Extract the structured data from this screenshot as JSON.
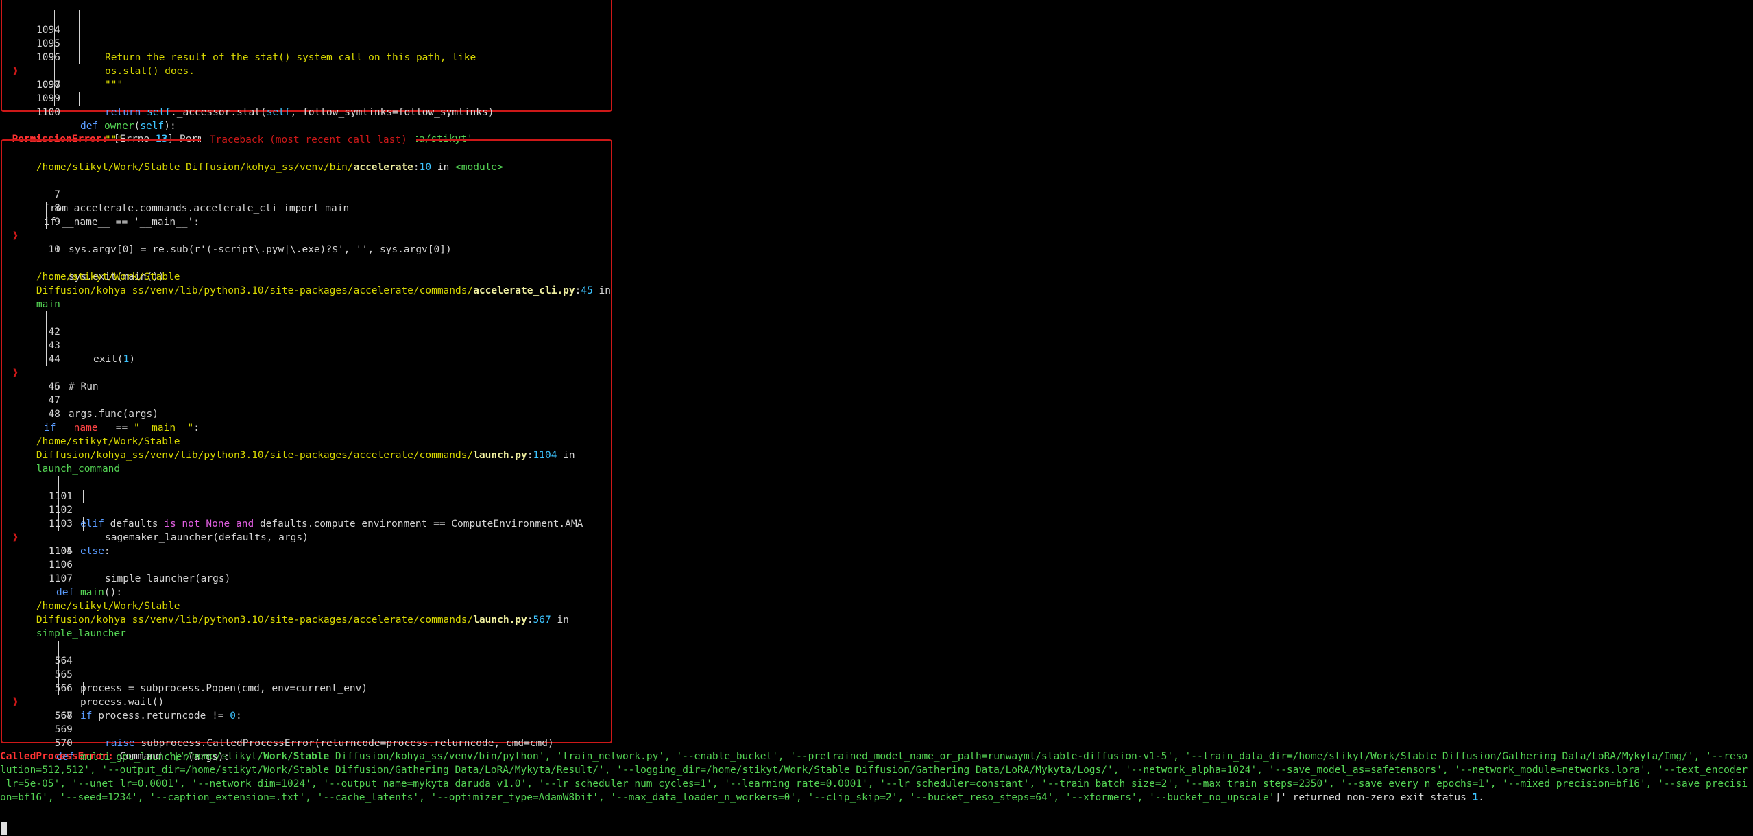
{
  "frame1": {
    "lines": [
      {
        "num": "1094",
        "text": "Return the result of the stat() system call on this path, like"
      },
      {
        "num": "1095",
        "text": "os.stat() does."
      },
      {
        "num": "1096",
        "text": "\"\"\""
      },
      {
        "num": "1097",
        "kw": "return",
        "self1": "self",
        "mid": "._accessor.stat(",
        "self2": "self",
        "tail": ", follow_symlinks=follow_symlinks)"
      },
      {
        "num": "1098",
        "text": ""
      },
      {
        "num": "1099",
        "kw": "def",
        "fn": "owner",
        "open": "(",
        "self": "self",
        "close": "):"
      },
      {
        "num": "1100",
        "text": "\"\"\""
      }
    ]
  },
  "permission_error": {
    "name": "PermissionError:",
    "pre": " [Errno ",
    "errno": "13",
    "mid": "] Permission denied: ",
    "path": "'/var/lib/lightdm-data/stikyt'"
  },
  "traceback": {
    "title": " Traceback (most recent call last) ",
    "frames": [
      {
        "path1": "/home/stikyt/Work/Stable Diffusion/kohya_ss/venv/bin/",
        "file": "accelerate",
        "colon": ":",
        "lineno": "10",
        "in": " in ",
        "func": "<module>",
        "lines": [
          {
            "num": "7",
            "text": "from accelerate.commands.accelerate_cli import main"
          },
          {
            "num": "8",
            "text": "if __name__ == '__main__':"
          },
          {
            "num": "9",
            "text": "sys.argv[0] = re.sub(r'(-script\\.pyw|\\.exe)?$', '', sys.argv[0])"
          },
          {
            "num": "10",
            "text": "sys.exit(main())"
          },
          {
            "num": "11",
            "text": ""
          }
        ]
      },
      {
        "path1": "/home/stikyt/Work/Stable",
        "path2": "Diffusion/kohya_ss/venv/lib/python3.10/site-packages/accelerate/commands/",
        "file": "accelerate_cli.py",
        "colon": ":",
        "lineno": "45",
        "in": " in",
        "func": "main",
        "lines": [
          {
            "num": "42",
            "text": "exit(",
            "num_arg": "1",
            "close": ")"
          },
          {
            "num": "43",
            "text": ""
          },
          {
            "num": "44",
            "text": "# Run"
          },
          {
            "num": "45",
            "text": "args.func(args)"
          },
          {
            "num": "46",
            "text": ""
          },
          {
            "num": "47",
            "text": ""
          },
          {
            "num": "48",
            "kw": "if",
            "name": "__name__",
            "eq": " == ",
            "str": "\"__main__\"",
            "colon": ":"
          }
        ]
      },
      {
        "path1": "/home/stikyt/Work/Stable",
        "path2": "Diffusion/kohya_ss/venv/lib/python3.10/site-packages/accelerate/commands/",
        "file": "launch.py",
        "colon": ":",
        "lineno": "1104",
        "in": " in",
        "func": "launch_command",
        "lines": [
          {
            "num": "1101",
            "kw": "elif",
            "a": " defaults ",
            "is": "is not",
            "sp": " ",
            "none": "None",
            "sp2": " ",
            "and": "and",
            "tail": " defaults.compute_environment == ComputeEnvironment.AMA"
          },
          {
            "num": "1102",
            "text": "sagemaker_launcher(defaults, args)"
          },
          {
            "num": "1103",
            "kw": "else",
            "colon": ":"
          },
          {
            "num": "1104",
            "text": "simple_launcher(args)"
          },
          {
            "num": "1105",
            "text": ""
          },
          {
            "num": "1106",
            "text": ""
          },
          {
            "num": "1107",
            "kw": "def",
            "fn": "main",
            "tail": "():"
          }
        ]
      },
      {
        "path1": "/home/stikyt/Work/Stable",
        "path2": "Diffusion/kohya_ss/venv/lib/python3.10/site-packages/accelerate/commands/",
        "file": "launch.py",
        "colon": ":",
        "lineno": "567",
        "in": " in",
        "func": "simple_launcher",
        "lines": [
          {
            "num": "564",
            "text": "process = subprocess.Popen(cmd, env=current_env)"
          },
          {
            "num": "565",
            "text": "process.wait()"
          },
          {
            "num": "566",
            "kw": "if",
            "a": " process.returncode != ",
            "zero": "0",
            "colon": ":"
          },
          {
            "num": "567",
            "kw": "raise",
            "tail": " subprocess.CalledProcessError(returncode=process.returncode, cmd=cmd)"
          },
          {
            "num": "568",
            "text": ""
          },
          {
            "num": "569",
            "text": ""
          },
          {
            "num": "570",
            "kw": "def",
            "fn": "multi_gpu_launcher",
            "tail": "(args):"
          }
        ]
      }
    ]
  },
  "called_process_error": {
    "name": "CalledProcessError:",
    "pre": " Command ",
    "q1": "'[",
    "path_a": "'/home/stikyt/",
    "work": "Work",
    "slash": "/",
    "stable": "Stable",
    "path_b": " Diffusion/kohya_ss/venv/bin/python'",
    "args": ", 'train_network.py', '--enable_bucket', '--pretrained_model_name_or_path=runwayml/stable-diffusion-v1-5', '--train_data_dir=/home/stikyt/Work/Stable Diffusion/Gathering Data/LoRA/Mykyta/Img/', '--resolution=512,512', '--output_dir=/home/stikyt/Work/Stable Diffusion/Gathering Data/LoRA/Mykyta/Result/', '--logging_dir=/home/stikyt/Work/Stable Diffusion/Gathering Data/LoRA/Mykyta/Logs/', '--network_alpha=1024', '--save_model_as=safetensors', '--network_module=networks.lora', '--text_encoder_lr=5e-05', '--unet_lr=0.0001', '--network_dim=1024', '--output_name=mykyta_daruda_v1.0', '--lr_scheduler_num_cycles=1', '--learning_rate=0.0001', '--lr_scheduler=constant', '--train_batch_size=2', '--max_train_steps=2350', '--save_every_n_epochs=1', '--mixed_precision=bf16', '--save_precision=bf16', '--seed=1234', '--caption_extension=.txt', '--cache_latents', '--optimizer_type=AdamW8bit', '--max_data_loader_n_workers=0', '--clip_skip=2', '--bucket_reso_steps=64', '--xformers', '--bucket_no_upscale'",
    "close": "]'",
    "tail": " returned non-zero exit status ",
    "status": "1",
    "period": "."
  },
  "icons": {
    "arrow": "❱"
  }
}
